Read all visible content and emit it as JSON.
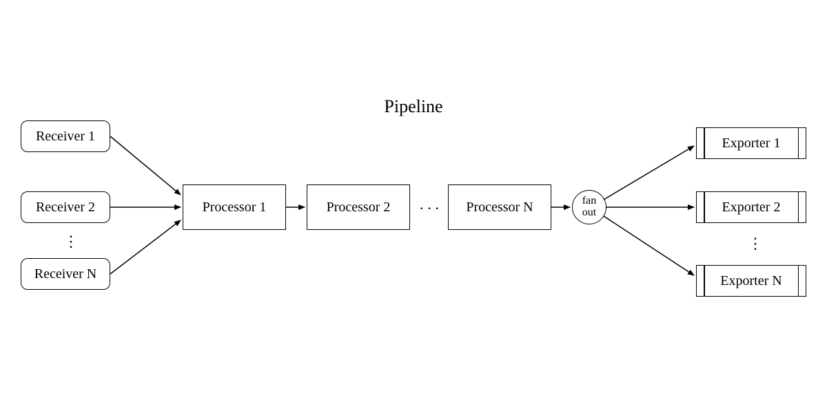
{
  "title": "Pipeline",
  "receivers": [
    "Receiver 1",
    "Receiver 2",
    "Receiver N"
  ],
  "receiver_ellipsis": "⋮",
  "processors": [
    "Processor 1",
    "Processor 2",
    "Processor N"
  ],
  "processor_ellipsis": "···",
  "fan_out_label": "fan\nout",
  "exporters": [
    "Exporter 1",
    "Exporter 2",
    "Exporter N"
  ],
  "exporter_ellipsis": "⋮"
}
